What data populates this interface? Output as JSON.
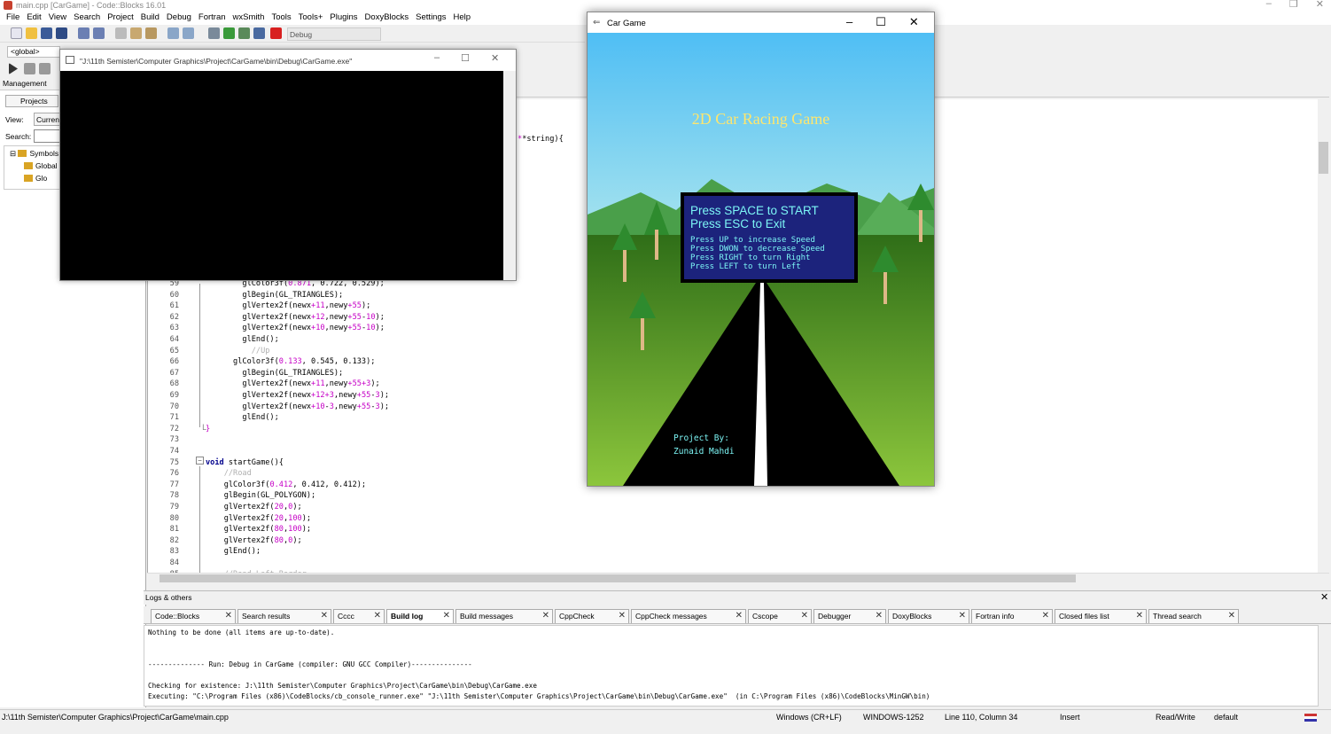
{
  "ide": {
    "window_title": "main.cpp [CarGame] - Code::Blocks 16.01",
    "menu": [
      "File",
      "Edit",
      "View",
      "Search",
      "Project",
      "Build",
      "Debug",
      "Fortran",
      "wxSmith",
      "Tools",
      "Tools+",
      "Plugins",
      "DoxyBlocks",
      "Settings",
      "Help"
    ],
    "build_target": "Debug",
    "scope": "<global>",
    "management_title": "Management",
    "projects_tab": "Projects",
    "view_label": "View:",
    "view_value": "Current",
    "search_label": "Search:",
    "tree": [
      "Symbols",
      "Global",
      "Glo"
    ],
    "editor_partial": "*string){",
    "code_lines": [
      {
        "n": "59",
        "text": "        glColor3f(0.871, 0.722, 0.529);"
      },
      {
        "n": "60",
        "text": "        glBegin(GL_TRIANGLES);"
      },
      {
        "n": "61",
        "text": "        glVertex2f(newx+11,newy+55);"
      },
      {
        "n": "62",
        "text": "        glVertex2f(newx+12,newy+55-10);"
      },
      {
        "n": "63",
        "text": "        glVertex2f(newx+10,newy+55-10);"
      },
      {
        "n": "64",
        "text": "        glEnd();"
      },
      {
        "n": "65",
        "text": "          //Up"
      },
      {
        "n": "66",
        "text": "      glColor3f(0.133, 0.545, 0.133);"
      },
      {
        "n": "67",
        "text": "        glBegin(GL_TRIANGLES);"
      },
      {
        "n": "68",
        "text": "        glVertex2f(newx+11,newy+55+3);"
      },
      {
        "n": "69",
        "text": "        glVertex2f(newx+12+3,newy+55-3);"
      },
      {
        "n": "70",
        "text": "        glVertex2f(newx+10-3,newy+55-3);"
      },
      {
        "n": "71",
        "text": "        glEnd();"
      },
      {
        "n": "72",
        "text": "}"
      },
      {
        "n": "73",
        "text": ""
      },
      {
        "n": "74",
        "text": ""
      },
      {
        "n": "75",
        "text": "void startGame(){"
      },
      {
        "n": "76",
        "text": "    //Road"
      },
      {
        "n": "77",
        "text": "    glColor3f(0.412, 0.412, 0.412);"
      },
      {
        "n": "78",
        "text": "    glBegin(GL_POLYGON);"
      },
      {
        "n": "79",
        "text": "    glVertex2f(20,0);"
      },
      {
        "n": "80",
        "text": "    glVertex2f(20,100);"
      },
      {
        "n": "81",
        "text": "    glVertex2f(80,100);"
      },
      {
        "n": "82",
        "text": "    glVertex2f(80,0);"
      },
      {
        "n": "83",
        "text": "    glEnd();"
      },
      {
        "n": "84",
        "text": ""
      },
      {
        "n": "85",
        "text": "    //Road Left Border"
      }
    ],
    "logs_title": "Logs & others",
    "log_tabs": [
      "Code::Blocks",
      "Search results",
      "Cccc",
      "Build log",
      "Build messages",
      "CppCheck",
      "CppCheck messages",
      "Cscope",
      "Debugger",
      "DoxyBlocks",
      "Fortran info",
      "Closed files list",
      "Thread search"
    ],
    "log_lines": [
      "Nothing to be done (all items are up-to-date).",
      "",
      "",
      "-------------- Run: Debug in CarGame (compiler: GNU GCC Compiler)---------------",
      "",
      "Checking for existence: J:\\11th Semister\\Computer Graphics\\Project\\CarGame\\bin\\Debug\\CarGame.exe",
      "Executing: \"C:\\Program Files (x86)\\CodeBlocks/cb_console_runner.exe\" \"J:\\11th Semister\\Computer Graphics\\Project\\CarGame\\bin\\Debug\\CarGame.exe\"  (in C:\\Program Files (x86)\\CodeBlocks\\MinGW\\bin)"
    ],
    "status": {
      "path": "J:\\11th Semister\\Computer Graphics\\Project\\CarGame\\main.cpp",
      "eol": "Windows (CR+LF)",
      "encoding": "WINDOWS-1252",
      "position": "Line 110, Column 34",
      "mode": "Insert",
      "access": "Read/Write",
      "profile": "default"
    }
  },
  "console": {
    "title": "\"J:\\11th Semister\\Computer Graphics\\Project\\CarGame\\bin\\Debug\\CarGame.exe\""
  },
  "game": {
    "window_title": "Car Game",
    "heading": "2D Car Racing Game",
    "start_line": "Press SPACE to START",
    "exit_line": "Press ESC to Exit",
    "instructions": [
      "Press UP to increase Speed",
      "Press DWON to decrease Speed",
      "Press RIGHT to turn Right",
      "Press LEFT to turn Left"
    ],
    "credit_label": "Project By:",
    "credit_name": "Zunaid Mahdi"
  },
  "colors": {
    "sky_top": "#4fbef4",
    "sky_bottom": "#a8e4ee",
    "grass": "#4b9e2a",
    "mountain": "#3e9a3e",
    "road": "#000000",
    "menu_bg": "#1c237c",
    "menu_text": "#7cf5f5",
    "heading_text": "#ffe66d"
  }
}
